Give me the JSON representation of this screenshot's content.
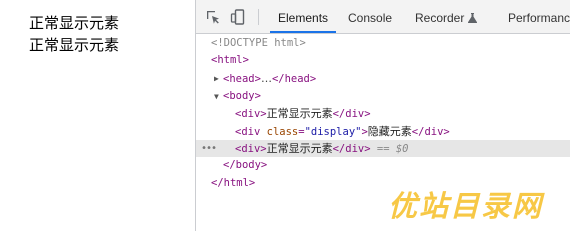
{
  "page": {
    "lines": [
      "正常显示元素",
      "正常显示元素"
    ]
  },
  "devtools": {
    "toolbar": {
      "icons": [
        "inspect-element-icon",
        "device-toolbar-icon"
      ],
      "tabs": [
        {
          "label": "Elements",
          "active": true
        },
        {
          "label": "Console",
          "active": false
        },
        {
          "label": "Recorder",
          "active": false,
          "icon": "flask-icon"
        },
        {
          "label": "Performance",
          "active": false
        }
      ]
    },
    "dom": {
      "doctype": "<!DOCTYPE html>",
      "html_open": "<html>",
      "head_open": "<head>",
      "ellipsis": "…",
      "head_close": "</head>",
      "body_open": "<body>",
      "div_open": "<div>",
      "div_class_open": "<div",
      "attr_name": "class",
      "attr_eq": "=",
      "attr_value": "\"display\"",
      "tag_end": ">",
      "div_close": "</div>",
      "body_close": "</body>",
      "html_close": "</html>",
      "text_1": "正常显示元素",
      "text_2": "隐藏元素",
      "text_3": "正常显示元素",
      "eq_sign": " == ",
      "console_ref": "$0",
      "gutter_dots": "•••"
    },
    "accent_color": "#1a73e8",
    "tag_color": "#881280",
    "attr_name_color": "#994500",
    "attr_value_color": "#1a1aa6",
    "selected_row_color": "#e6e6e6"
  },
  "watermark": {
    "text": "优站目录网",
    "color": "#f5b400"
  }
}
